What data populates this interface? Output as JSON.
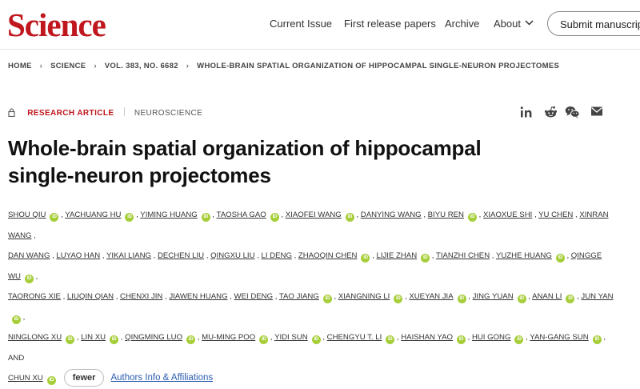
{
  "header": {
    "logo": "Science",
    "nav": {
      "current_issue": "Current Issue",
      "first_release": "First release papers",
      "archive": "Archive",
      "about": "About"
    },
    "submit": "Submit manuscript"
  },
  "breadcrumb": [
    "HOME",
    "SCIENCE",
    "VOL. 383, NO. 6682",
    "WHOLE-BRAIN SPATIAL ORGANIZATION OF HIPPOCAMPAL SINGLE-NEURON PROJECTOMES"
  ],
  "article": {
    "type": "RESEARCH ARTICLE",
    "subject": "NEUROSCIENCE",
    "title_line1": "Whole-brain spatial organization of hippocampal",
    "title_line2": "single-neuron projectomes"
  },
  "share_icons": [
    "linkedin-icon",
    "reddit-icon",
    "wechat-icon",
    "email-icon"
  ],
  "authors": [
    {
      "name": "SHOU QIU",
      "orcid": true
    },
    {
      "name": "YACHUANG HU",
      "orcid": true
    },
    {
      "name": "YIMING HUANG",
      "orcid": true
    },
    {
      "name": "TAOSHA GAO",
      "orcid": true
    },
    {
      "name": "XIAOFEI WANG",
      "orcid": true
    },
    {
      "name": "DANYING WANG",
      "orcid": false
    },
    {
      "name": "BIYU REN",
      "orcid": true
    },
    {
      "name": "XIAOXUE SHI",
      "orcid": false
    },
    {
      "name": "YU CHEN",
      "orcid": false
    },
    {
      "name": "XINRAN WANG",
      "orcid": false
    },
    {
      "name": "DAN WANG",
      "orcid": false
    },
    {
      "name": "LUYAO HAN",
      "orcid": false
    },
    {
      "name": "YIKAI LIANG",
      "orcid": false
    },
    {
      "name": "DECHEN LIU",
      "orcid": false
    },
    {
      "name": "QINGXU LIU",
      "orcid": false
    },
    {
      "name": "LI DENG",
      "orcid": false
    },
    {
      "name": "ZHAOQIN CHEN",
      "orcid": true
    },
    {
      "name": "LIJIE ZHAN",
      "orcid": true
    },
    {
      "name": "TIANZHI CHEN",
      "orcid": false
    },
    {
      "name": "YUZHE HUANG",
      "orcid": true
    },
    {
      "name": "QINGGE WU",
      "orcid": true
    },
    {
      "name": "TAORONG XIE",
      "orcid": false
    },
    {
      "name": "LIUQIN QIAN",
      "orcid": false
    },
    {
      "name": "CHENXI JIN",
      "orcid": false
    },
    {
      "name": "JIAWEN HUANG",
      "orcid": false
    },
    {
      "name": "WEI DENG",
      "orcid": false
    },
    {
      "name": "TAO JIANG",
      "orcid": true
    },
    {
      "name": "XIANGNING LI",
      "orcid": true
    },
    {
      "name": "XUEYAN JIA",
      "orcid": true
    },
    {
      "name": "JING YUAN",
      "orcid": true
    },
    {
      "name": "ANAN LI",
      "orcid": true
    },
    {
      "name": "JUN YAN",
      "orcid": true
    },
    {
      "name": "NINGLONG XU",
      "orcid": true
    },
    {
      "name": "LIN XU",
      "orcid": true
    },
    {
      "name": "QINGMING LUO",
      "orcid": true
    },
    {
      "name": "MU-MING POO",
      "orcid": true
    },
    {
      "name": "YIDI SUN",
      "orcid": true
    },
    {
      "name": "CHENGYU T. LI",
      "orcid": true
    },
    {
      "name": "HAISHAN YAO",
      "orcid": true
    },
    {
      "name": "HUI GONG",
      "orcid": true
    },
    {
      "name": "YAN-GANG SUN",
      "orcid": true
    },
    {
      "name": "CHUN XU",
      "orcid": true
    }
  ],
  "authors_rows": [
    [
      0,
      10
    ],
    [
      10,
      21
    ],
    [
      21,
      32
    ],
    [
      32,
      41
    ],
    [
      41,
      42
    ]
  ],
  "and_text": ", AND",
  "orcid_text": "iD",
  "fewer": "fewer",
  "affiliations": "Authors Info & Affiliations",
  "colors": {
    "brand_red": "#c0161d",
    "orcid_green": "#a6ce39",
    "link_blue": "#2a5db0"
  }
}
